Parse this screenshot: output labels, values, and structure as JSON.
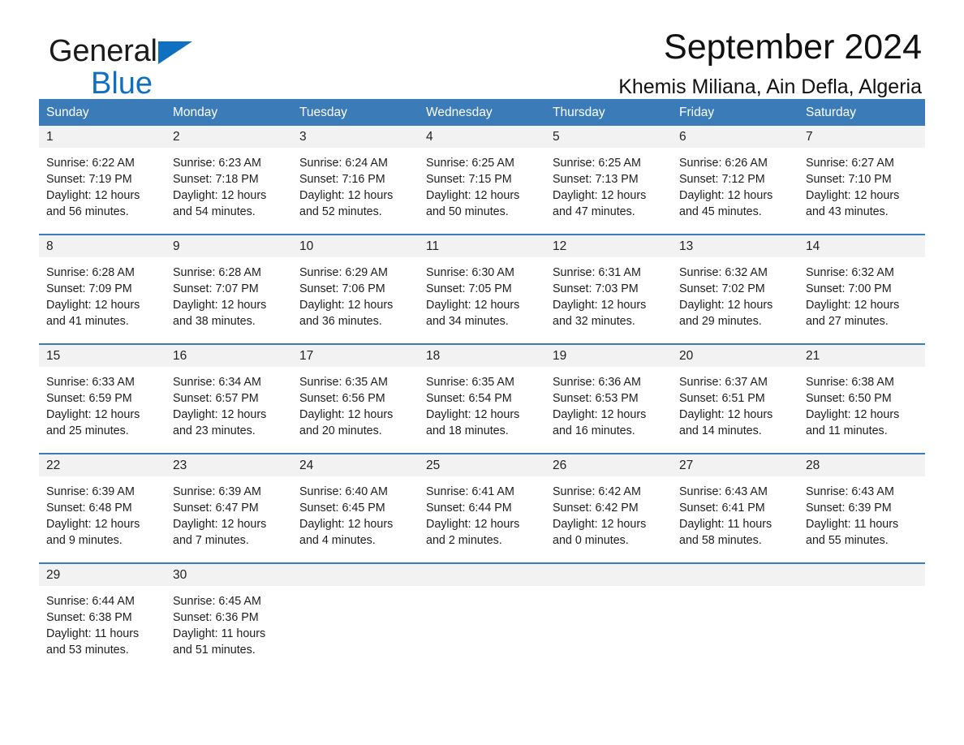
{
  "brand": {
    "name_part1": "General",
    "name_part2": "Blue",
    "flag_icon": "triangle-flag-icon",
    "accent_color": "#0f6fc0"
  },
  "header": {
    "title": "September 2024",
    "subtitle": "Khemis Miliana, Ain Defla, Algeria"
  },
  "calendar": {
    "header_color": "#3b7cb8",
    "day_number_bg": "#f2f2f2",
    "weekdays": [
      "Sunday",
      "Monday",
      "Tuesday",
      "Wednesday",
      "Thursday",
      "Friday",
      "Saturday"
    ],
    "weeks": [
      [
        {
          "day": "1",
          "sunrise": "Sunrise: 6:22 AM",
          "sunset": "Sunset: 7:19 PM",
          "daylight": "Daylight: 12 hours and 56 minutes."
        },
        {
          "day": "2",
          "sunrise": "Sunrise: 6:23 AM",
          "sunset": "Sunset: 7:18 PM",
          "daylight": "Daylight: 12 hours and 54 minutes."
        },
        {
          "day": "3",
          "sunrise": "Sunrise: 6:24 AM",
          "sunset": "Sunset: 7:16 PM",
          "daylight": "Daylight: 12 hours and 52 minutes."
        },
        {
          "day": "4",
          "sunrise": "Sunrise: 6:25 AM",
          "sunset": "Sunset: 7:15 PM",
          "daylight": "Daylight: 12 hours and 50 minutes."
        },
        {
          "day": "5",
          "sunrise": "Sunrise: 6:25 AM",
          "sunset": "Sunset: 7:13 PM",
          "daylight": "Daylight: 12 hours and 47 minutes."
        },
        {
          "day": "6",
          "sunrise": "Sunrise: 6:26 AM",
          "sunset": "Sunset: 7:12 PM",
          "daylight": "Daylight: 12 hours and 45 minutes."
        },
        {
          "day": "7",
          "sunrise": "Sunrise: 6:27 AM",
          "sunset": "Sunset: 7:10 PM",
          "daylight": "Daylight: 12 hours and 43 minutes."
        }
      ],
      [
        {
          "day": "8",
          "sunrise": "Sunrise: 6:28 AM",
          "sunset": "Sunset: 7:09 PM",
          "daylight": "Daylight: 12 hours and 41 minutes."
        },
        {
          "day": "9",
          "sunrise": "Sunrise: 6:28 AM",
          "sunset": "Sunset: 7:07 PM",
          "daylight": "Daylight: 12 hours and 38 minutes."
        },
        {
          "day": "10",
          "sunrise": "Sunrise: 6:29 AM",
          "sunset": "Sunset: 7:06 PM",
          "daylight": "Daylight: 12 hours and 36 minutes."
        },
        {
          "day": "11",
          "sunrise": "Sunrise: 6:30 AM",
          "sunset": "Sunset: 7:05 PM",
          "daylight": "Daylight: 12 hours and 34 minutes."
        },
        {
          "day": "12",
          "sunrise": "Sunrise: 6:31 AM",
          "sunset": "Sunset: 7:03 PM",
          "daylight": "Daylight: 12 hours and 32 minutes."
        },
        {
          "day": "13",
          "sunrise": "Sunrise: 6:32 AM",
          "sunset": "Sunset: 7:02 PM",
          "daylight": "Daylight: 12 hours and 29 minutes."
        },
        {
          "day": "14",
          "sunrise": "Sunrise: 6:32 AM",
          "sunset": "Sunset: 7:00 PM",
          "daylight": "Daylight: 12 hours and 27 minutes."
        }
      ],
      [
        {
          "day": "15",
          "sunrise": "Sunrise: 6:33 AM",
          "sunset": "Sunset: 6:59 PM",
          "daylight": "Daylight: 12 hours and 25 minutes."
        },
        {
          "day": "16",
          "sunrise": "Sunrise: 6:34 AM",
          "sunset": "Sunset: 6:57 PM",
          "daylight": "Daylight: 12 hours and 23 minutes."
        },
        {
          "day": "17",
          "sunrise": "Sunrise: 6:35 AM",
          "sunset": "Sunset: 6:56 PM",
          "daylight": "Daylight: 12 hours and 20 minutes."
        },
        {
          "day": "18",
          "sunrise": "Sunrise: 6:35 AM",
          "sunset": "Sunset: 6:54 PM",
          "daylight": "Daylight: 12 hours and 18 minutes."
        },
        {
          "day": "19",
          "sunrise": "Sunrise: 6:36 AM",
          "sunset": "Sunset: 6:53 PM",
          "daylight": "Daylight: 12 hours and 16 minutes."
        },
        {
          "day": "20",
          "sunrise": "Sunrise: 6:37 AM",
          "sunset": "Sunset: 6:51 PM",
          "daylight": "Daylight: 12 hours and 14 minutes."
        },
        {
          "day": "21",
          "sunrise": "Sunrise: 6:38 AM",
          "sunset": "Sunset: 6:50 PM",
          "daylight": "Daylight: 12 hours and 11 minutes."
        }
      ],
      [
        {
          "day": "22",
          "sunrise": "Sunrise: 6:39 AM",
          "sunset": "Sunset: 6:48 PM",
          "daylight": "Daylight: 12 hours and 9 minutes."
        },
        {
          "day": "23",
          "sunrise": "Sunrise: 6:39 AM",
          "sunset": "Sunset: 6:47 PM",
          "daylight": "Daylight: 12 hours and 7 minutes."
        },
        {
          "day": "24",
          "sunrise": "Sunrise: 6:40 AM",
          "sunset": "Sunset: 6:45 PM",
          "daylight": "Daylight: 12 hours and 4 minutes."
        },
        {
          "day": "25",
          "sunrise": "Sunrise: 6:41 AM",
          "sunset": "Sunset: 6:44 PM",
          "daylight": "Daylight: 12 hours and 2 minutes."
        },
        {
          "day": "26",
          "sunrise": "Sunrise: 6:42 AM",
          "sunset": "Sunset: 6:42 PM",
          "daylight": "Daylight: 12 hours and 0 minutes."
        },
        {
          "day": "27",
          "sunrise": "Sunrise: 6:43 AM",
          "sunset": "Sunset: 6:41 PM",
          "daylight": "Daylight: 11 hours and 58 minutes."
        },
        {
          "day": "28",
          "sunrise": "Sunrise: 6:43 AM",
          "sunset": "Sunset: 6:39 PM",
          "daylight": "Daylight: 11 hours and 55 minutes."
        }
      ],
      [
        {
          "day": "29",
          "sunrise": "Sunrise: 6:44 AM",
          "sunset": "Sunset: 6:38 PM",
          "daylight": "Daylight: 11 hours and 53 minutes."
        },
        {
          "day": "30",
          "sunrise": "Sunrise: 6:45 AM",
          "sunset": "Sunset: 6:36 PM",
          "daylight": "Daylight: 11 hours and 51 minutes."
        },
        {
          "day": "",
          "sunrise": "",
          "sunset": "",
          "daylight": ""
        },
        {
          "day": "",
          "sunrise": "",
          "sunset": "",
          "daylight": ""
        },
        {
          "day": "",
          "sunrise": "",
          "sunset": "",
          "daylight": ""
        },
        {
          "day": "",
          "sunrise": "",
          "sunset": "",
          "daylight": ""
        },
        {
          "day": "",
          "sunrise": "",
          "sunset": "",
          "daylight": ""
        }
      ]
    ]
  }
}
